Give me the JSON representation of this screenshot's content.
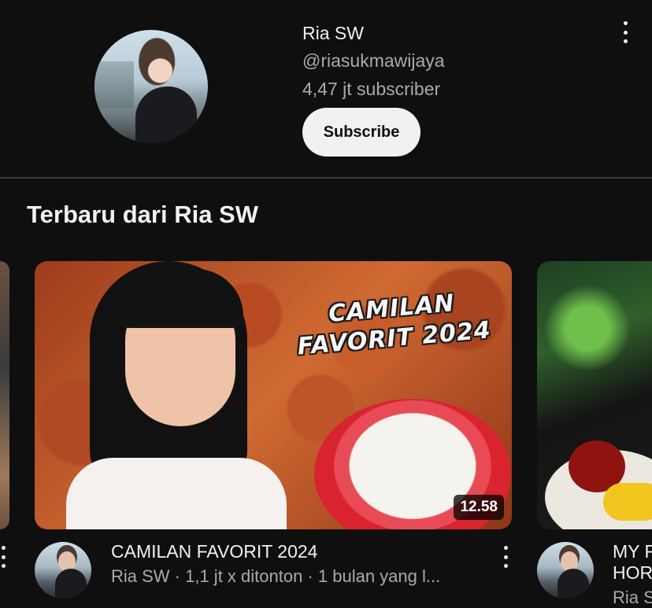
{
  "channel": {
    "name": "Ria SW",
    "handle": "@riasukmawijaya",
    "subscribers": "4,47 jt subscriber",
    "subscribe_label": "Subscribe",
    "avatar_icon": "channel-avatar"
  },
  "section": {
    "title": "Terbaru dari Ria SW"
  },
  "videos": [
    {
      "thumbnail_text": "CAMILAN FAVORIT 2024",
      "duration": "12.58",
      "title": "CAMILAN FAVORIT 2024",
      "meta": "Ria SW · 1,1 jt x ditonton · 1 bulan yang l..."
    },
    {
      "title_line1": "MY F",
      "title_line2": "HOR",
      "meta": "Ria S"
    }
  ],
  "colors": {
    "background": "#0f0f0f",
    "text_primary": "#f1f1f1",
    "text_secondary": "#aaaaaa",
    "subscribe_bg": "#f1f1f1"
  }
}
